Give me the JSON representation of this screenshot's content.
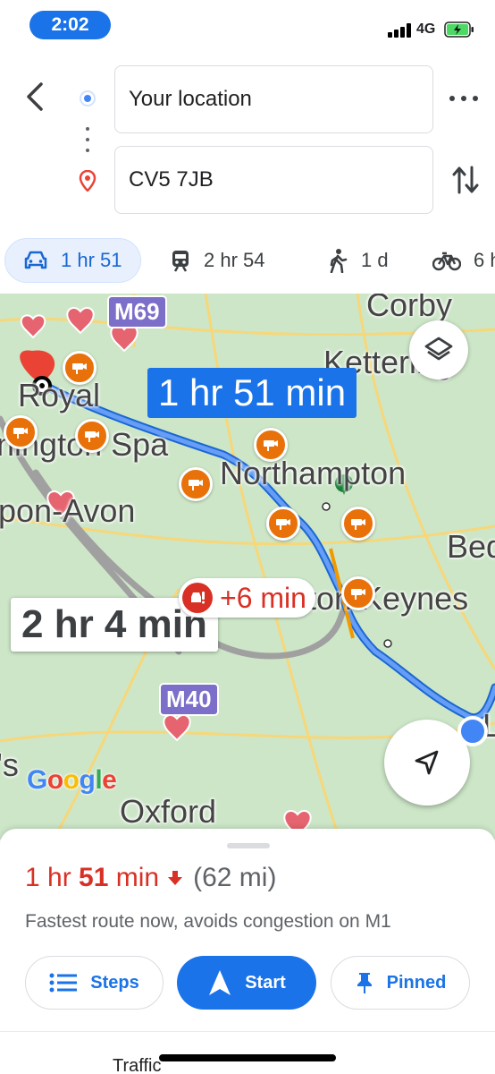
{
  "status_bar": {
    "time": "2:02",
    "network": "4G",
    "icons": [
      "signal-bars-icon",
      "battery-charging-icon"
    ],
    "battery_color": "#4cd964"
  },
  "header": {
    "origin": {
      "value": "Your location",
      "icon": "current-location-dot-icon"
    },
    "destination": {
      "value": "CV5 7JB",
      "icon": "destination-pin-icon"
    },
    "icons": [
      "back-arrow-icon",
      "more-vert-icon",
      "swap-icon"
    ]
  },
  "modes": [
    {
      "icon": "car-icon",
      "label": "1 hr 51",
      "selected": true
    },
    {
      "icon": "train-icon",
      "label": "2 hr 54",
      "selected": false
    },
    {
      "icon": "walk-icon",
      "label": "1 d",
      "selected": false
    },
    {
      "icon": "bike-icon",
      "label": "6 h",
      "selected": false
    }
  ],
  "map": {
    "places": {
      "corby": "Corby",
      "kettering": "Kettering",
      "royal": "Royal",
      "leamington": "nington Spa",
      "northampton": "Northampton",
      "stratford": "pon-Avon",
      "bedford": "Bed",
      "milton_keynes": "Milton Keynes",
      "oxford": "Oxford",
      "partial_ds": "'s",
      "partial_l": "L"
    },
    "motorways": {
      "m69": "M69",
      "m40": "M40"
    },
    "route_primary_label": "1 hr 51 min",
    "route_alt_label": "2 hr 4 min",
    "delay_label": "+6 min",
    "logo": "Google",
    "colors": {
      "route": "#4285f4",
      "route_alt": "#9aa0a6",
      "camera": "#e8710a",
      "delay": "#d93025",
      "pin": "#ea4335"
    }
  },
  "sheet": {
    "duration_prefix": "1 hr ",
    "duration_number": "51",
    "duration_suffix": " min",
    "distance": "(62 mi)",
    "subtitle": "Fastest route now, avoids congestion on M1",
    "buttons": {
      "steps": "Steps",
      "start": "Start",
      "pinned": "Pinned"
    },
    "tab_label": "Traffic"
  },
  "accent_color": "#1a73e8"
}
